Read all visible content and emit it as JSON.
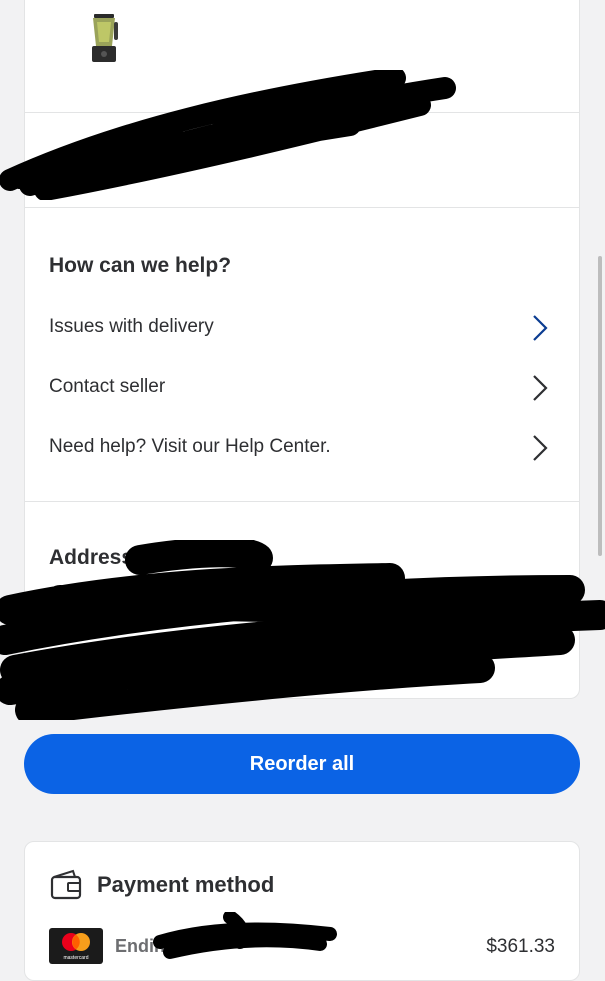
{
  "product": {
    "icon": "blender-product-image"
  },
  "help": {
    "title": "How can we help?",
    "items": [
      {
        "label": "Issues with delivery",
        "icon": "chevron-right-icon",
        "color": "#0b3c91"
      },
      {
        "label": "Contact seller",
        "icon": "chevron-right-icon",
        "color": "#2e2f32"
      },
      {
        "label": "Need help? Visit our Help Center.",
        "icon": "chevron-right-icon",
        "color": "#2e2f32"
      }
    ]
  },
  "address": {
    "title": "Address"
  },
  "actions": {
    "reorder_label": "Reorder all"
  },
  "payment": {
    "title": "Payment method",
    "card_brand": "mastercard",
    "ending_label": "Ending",
    "amount": "$361.33"
  },
  "colors": {
    "accent": "#0b63e5",
    "text": "#2e2f32",
    "background": "#f2f2f3"
  }
}
